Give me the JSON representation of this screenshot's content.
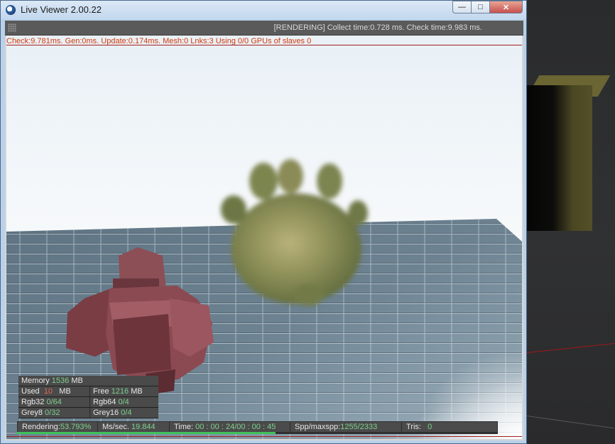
{
  "window": {
    "title": "Live Viewer 2.00.22",
    "buttons": {
      "minimize": "—",
      "maximize": "□",
      "close": "✕"
    }
  },
  "toolbar": {
    "grip_icon": "grip-icon",
    "status": "[RENDERING] Collect time:0.728 ms.  Check time:9.983 ms."
  },
  "debug": {
    "text": "Check:9.781ms. Gen:0ms. Update:0.174ms. Mesh:0 Lnks:3   Using 0/0 GPUs of slaves 0"
  },
  "memory": {
    "memory_label": "Memory",
    "memory_value": "1536",
    "memory_unit": "MB",
    "used_label": "Used",
    "used_value": "10",
    "used_unit": "MB",
    "free_label": "Free",
    "free_value": "1216",
    "free_unit": "MB",
    "rgb32_label": "Rgb32",
    "rgb32_value": "0/64",
    "rgb64_label": "Rgb64",
    "rgb64_value": "0/4",
    "grey8_label": "Grey8",
    "grey8_value": "0/32",
    "grey16_label": "Grey16",
    "grey16_value": "0/4"
  },
  "render_stats": {
    "rendering_label": "Rendering:",
    "rendering_value": "53.793%",
    "ms_label": "Ms/sec.",
    "ms_value": "19.844",
    "time_label": "Time:",
    "time_value": "00 : 00 : 24/00 : 00 : 45",
    "spp_label": "Spp/maxspp:",
    "spp_value": "1255/2333",
    "tris_label": "Tris:",
    "tris_value": "0",
    "progress_fraction": 0.538
  },
  "colors": {
    "debug_text": "#d23a0c",
    "value_green": "#7fd08f",
    "value_red": "#e36a5a",
    "progress": "#3ec25a"
  }
}
